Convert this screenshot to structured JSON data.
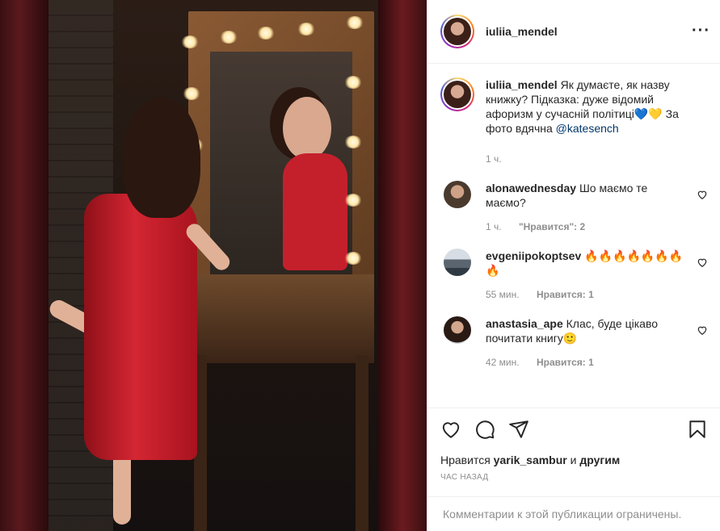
{
  "header": {
    "username": "iuliia_mendel",
    "more_icon": "more-dots-icon"
  },
  "caption": {
    "username": "iuliia_mendel",
    "text_1": "Як думаєте, як назву книжку? Підказка: дуже відомий афоризм у сучасній політиці",
    "emoji": "💙💛",
    "text_2": " За фото вдячна ",
    "mention": "@katesench",
    "time": "1 ч."
  },
  "comments": [
    {
      "username": "alonawednesday",
      "text": "Шо маємо те маємо?",
      "time": "1 ч.",
      "likes": "\"Нравится\": 2"
    },
    {
      "username": "evgeniipokoptsev",
      "text": "🔥🔥🔥🔥🔥🔥🔥🔥",
      "time": "55 мин.",
      "likes": "Нравится: 1"
    },
    {
      "username": "anastasia_ape",
      "text": "Клас, буде цікаво почитати книгу🙂",
      "time": "42 мин.",
      "likes": "Нравится: 1"
    }
  ],
  "actions": {
    "like_icon": "heart-icon",
    "comment_icon": "comment-icon",
    "share_icon": "share-icon",
    "save_icon": "bookmark-icon",
    "likes_prefix": "Нравится",
    "likes_user": "yarik_sambur",
    "likes_joiner": "и",
    "likes_suffix": "другим",
    "time": "ЧАС НАЗАД"
  },
  "footer": {
    "restricted_text": "Комментарии к этой публикации ограничены."
  }
}
